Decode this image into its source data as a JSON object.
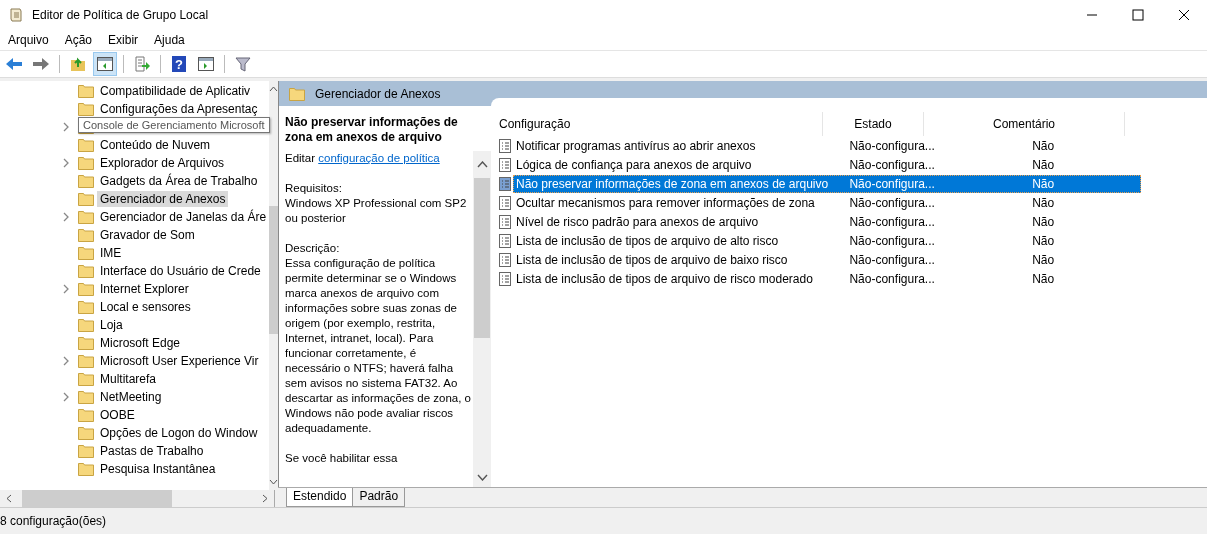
{
  "window": {
    "title": "Editor de Política de Grupo Local"
  },
  "menu": [
    "Arquivo",
    "Ação",
    "Exibir",
    "Ajuda"
  ],
  "toolbar": [
    {
      "kind": "back"
    },
    {
      "kind": "forward"
    },
    {
      "kind": "sep"
    },
    {
      "kind": "up"
    },
    {
      "kind": "pane",
      "selected": true
    },
    {
      "kind": "sep"
    },
    {
      "kind": "export"
    },
    {
      "kind": "sep"
    },
    {
      "kind": "help",
      "glyph": "?"
    },
    {
      "kind": "pane2",
      "selected": false
    },
    {
      "kind": "sep"
    },
    {
      "kind": "filter"
    }
  ],
  "tree": {
    "items": [
      {
        "label": "Compatibilidade de Aplicativ",
        "expandable": false,
        "selected": false
      },
      {
        "label": "Configurações da Apresentaç",
        "expandable": false,
        "selected": false
      },
      {
        "label": "Console de Gerenciamento Microsoft",
        "expandable": true,
        "selected": false,
        "tooltip": true
      },
      {
        "label": "Conteúdo de Nuvem",
        "expandable": false,
        "selected": false
      },
      {
        "label": "Explorador de Arquivos",
        "expandable": true,
        "selected": false
      },
      {
        "label": "Gadgets da Área de Trabalho",
        "expandable": false,
        "selected": false
      },
      {
        "label": "Gerenciador de Anexos",
        "expandable": false,
        "selected": true
      },
      {
        "label": "Gerenciador de Janelas da Áre",
        "expandable": true,
        "selected": false
      },
      {
        "label": "Gravador de Som",
        "expandable": false,
        "selected": false
      },
      {
        "label": "IME",
        "expandable": false,
        "selected": false
      },
      {
        "label": "Interface do Usuário de Crede",
        "expandable": false,
        "selected": false
      },
      {
        "label": "Internet Explorer",
        "expandable": true,
        "selected": false
      },
      {
        "label": "Local e sensores",
        "expandable": false,
        "selected": false
      },
      {
        "label": "Loja",
        "expandable": false,
        "selected": false
      },
      {
        "label": "Microsoft Edge",
        "expandable": false,
        "selected": false
      },
      {
        "label": "Microsoft User Experience Vir",
        "expandable": true,
        "selected": false
      },
      {
        "label": "Multitarefa",
        "expandable": false,
        "selected": false
      },
      {
        "label": "NetMeeting",
        "expandable": true,
        "selected": false
      },
      {
        "label": "OOBE",
        "expandable": false,
        "selected": false
      },
      {
        "label": "Opções de Logon do Window",
        "expandable": false,
        "selected": false
      },
      {
        "label": "Pastas de Trabalho",
        "expandable": false,
        "selected": false
      },
      {
        "label": "Pesquisa Instantânea",
        "expandable": false,
        "selected": false
      }
    ]
  },
  "panel": {
    "title": "Gerenciador de Anexos"
  },
  "details": {
    "title": "Não preservar informações de zona em anexos de arquivo",
    "edit_prefix": "Editar",
    "edit_link": "configuração de política",
    "requirements_label": "Requisitos:",
    "requirements": "Windows XP Professional com SP2 ou posterior",
    "description_label": "Descrição:",
    "description": "Essa configuração de política permite determinar se o Windows marca anexos de arquivo com informações sobre suas zonas de origem (por exemplo, restrita, Internet, intranet, local). Para funcionar corretamente, é necessário o NTFS; haverá falha sem avisos no sistema FAT32. Ao descartar as informações de zona, o Windows não pode avaliar riscos adequadamente.",
    "more": "Se você habilitar essa"
  },
  "bottom_tabs": [
    {
      "label": "Estendido",
      "selected": true
    },
    {
      "label": "Padrão",
      "selected": false
    }
  ],
  "table": {
    "columns": [
      "Configuração",
      "Estado",
      "Comentário"
    ],
    "rows": [
      {
        "setting": "Notificar programas antivírus ao abrir anexos",
        "state": "Não-configura...",
        "comment": "Não",
        "selected": false
      },
      {
        "setting": "Lógica de confiança para anexos de arquivo",
        "state": "Não-configura...",
        "comment": "Não",
        "selected": false
      },
      {
        "setting": "Não preservar informações de zona em anexos de arquivo",
        "state": "Não-configura...",
        "comment": "Não",
        "selected": true
      },
      {
        "setting": "Ocultar mecanismos para remover informações de zona",
        "state": "Não-configura...",
        "comment": "Não",
        "selected": false
      },
      {
        "setting": "Nível de risco padrão para anexos de arquivo",
        "state": "Não-configura...",
        "comment": "Não",
        "selected": false
      },
      {
        "setting": "Lista de inclusão de tipos de arquivo de alto risco",
        "state": "Não-configura...",
        "comment": "Não",
        "selected": false
      },
      {
        "setting": "Lista de inclusão de tipos de arquivo de baixo risco",
        "state": "Não-configura...",
        "comment": "Não",
        "selected": false
      },
      {
        "setting": "Lista de inclusão de tipos de arquivo de risco moderado",
        "state": "Não-configura...",
        "comment": "Não",
        "selected": false
      }
    ]
  },
  "status_bar": {
    "text": "8 configuração(ões)"
  }
}
